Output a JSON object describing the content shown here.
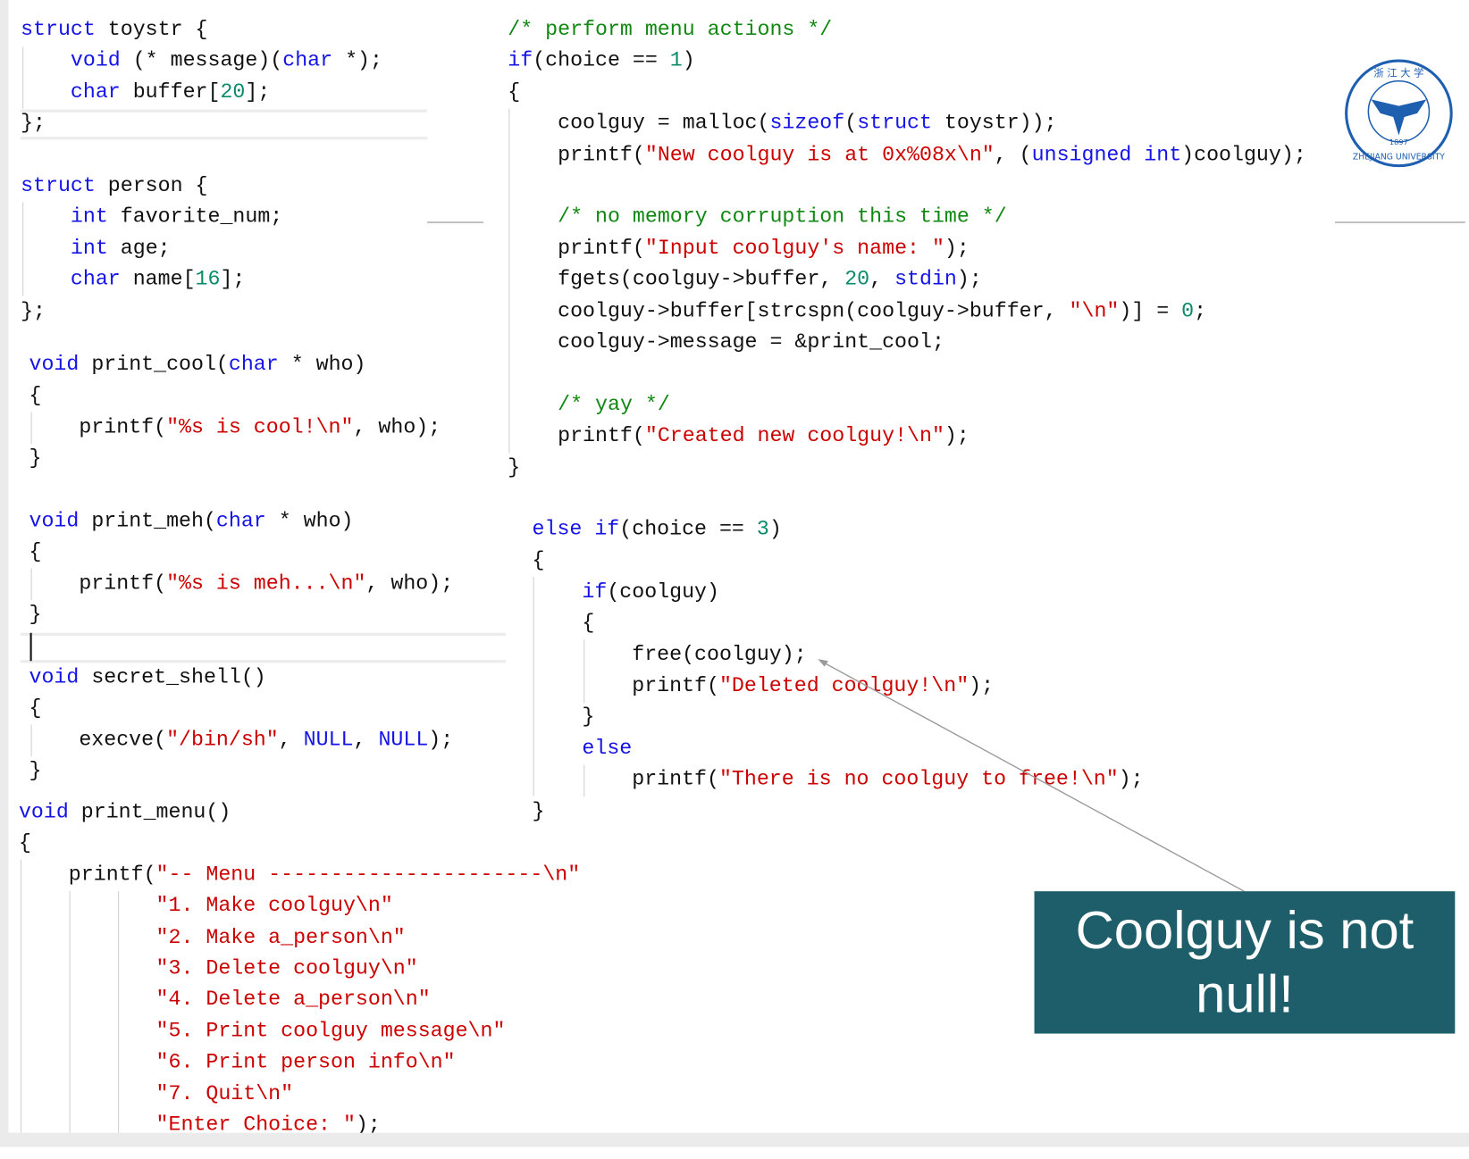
{
  "code_blocks": [
    {
      "name": "struct-definitions",
      "lines": [
        [
          [
            "k",
            "struct"
          ],
          [
            "p",
            " toystr {"
          ]
        ],
        [
          [
            "p",
            "    "
          ],
          [
            "k",
            "void"
          ],
          [
            "p",
            " (* message)("
          ],
          [
            "k",
            "char"
          ],
          [
            "p",
            " *);"
          ]
        ],
        [
          [
            "p",
            "    "
          ],
          [
            "k",
            "char"
          ],
          [
            "p",
            " buffer["
          ],
          [
            "n",
            "20"
          ],
          [
            "p",
            "];"
          ]
        ],
        [
          [
            "p",
            "};"
          ]
        ],
        [],
        [
          [
            "k",
            "struct"
          ],
          [
            "p",
            " person {"
          ]
        ],
        [
          [
            "p",
            "    "
          ],
          [
            "k",
            "int"
          ],
          [
            "p",
            " favorite_num;"
          ]
        ],
        [
          [
            "p",
            "    "
          ],
          [
            "k",
            "int"
          ],
          [
            "p",
            " age;"
          ]
        ],
        [
          [
            "p",
            "    "
          ],
          [
            "k",
            "char"
          ],
          [
            "p",
            " name["
          ],
          [
            "n",
            "16"
          ],
          [
            "p",
            "];"
          ]
        ],
        [
          [
            "p",
            "};"
          ]
        ]
      ]
    },
    {
      "name": "helper-functions",
      "lines": [
        [
          [
            "k",
            "void"
          ],
          [
            "p",
            " print_cool("
          ],
          [
            "k",
            "char"
          ],
          [
            "p",
            " * who)"
          ]
        ],
        [
          [
            "p",
            "{"
          ]
        ],
        [
          [
            "p",
            "    printf("
          ],
          [
            "s",
            "\"%s is cool!\\n\""
          ],
          [
            "p",
            ", who);"
          ]
        ],
        [
          [
            "p",
            "}"
          ]
        ],
        [],
        [
          [
            "k",
            "void"
          ],
          [
            "p",
            " print_meh("
          ],
          [
            "k",
            "char"
          ],
          [
            "p",
            " * who)"
          ]
        ],
        [
          [
            "p",
            "{"
          ]
        ],
        [
          [
            "p",
            "    printf("
          ],
          [
            "s",
            "\"%s is meh...\\n\""
          ],
          [
            "p",
            ", who);"
          ]
        ],
        [
          [
            "p",
            "}"
          ]
        ],
        [],
        [
          [
            "k",
            "void"
          ],
          [
            "p",
            " secret_shell()"
          ]
        ],
        [
          [
            "p",
            "{"
          ]
        ],
        [
          [
            "p",
            "    execve("
          ],
          [
            "s",
            "\"/bin/sh\""
          ],
          [
            "p",
            ", "
          ],
          [
            "k",
            "NULL"
          ],
          [
            "p",
            ", "
          ],
          [
            "k",
            "NULL"
          ],
          [
            "p",
            ");"
          ]
        ],
        [
          [
            "p",
            "}"
          ]
        ]
      ]
    },
    {
      "name": "print-menu-function",
      "lines": [
        [
          [
            "k",
            "void"
          ],
          [
            "p",
            " print_menu()"
          ]
        ],
        [
          [
            "p",
            "{"
          ]
        ],
        [
          [
            "p",
            "    printf("
          ],
          [
            "s",
            "\"-- Menu ----------------------\\n\""
          ]
        ],
        [
          [
            "p",
            "           "
          ],
          [
            "s",
            "\"1. Make coolguy\\n\""
          ]
        ],
        [
          [
            "p",
            "           "
          ],
          [
            "s",
            "\"2. Make a_person\\n\""
          ]
        ],
        [
          [
            "p",
            "           "
          ],
          [
            "s",
            "\"3. Delete coolguy\\n\""
          ]
        ],
        [
          [
            "p",
            "           "
          ],
          [
            "s",
            "\"4. Delete a_person\\n\""
          ]
        ],
        [
          [
            "p",
            "           "
          ],
          [
            "s",
            "\"5. Print coolguy message\\n\""
          ]
        ],
        [
          [
            "p",
            "           "
          ],
          [
            "s",
            "\"6. Print person info\\n\""
          ]
        ],
        [
          [
            "p",
            "           "
          ],
          [
            "s",
            "\"7. Quit\\n\""
          ]
        ],
        [
          [
            "p",
            "           "
          ],
          [
            "s",
            "\"Enter Choice: \""
          ],
          [
            "p",
            ");"
          ]
        ]
      ]
    },
    {
      "name": "menu-action-choice-1",
      "lines": [
        [
          [
            "c",
            "/* perform menu actions */"
          ]
        ],
        [
          [
            "k",
            "if"
          ],
          [
            "p",
            "(choice == "
          ],
          [
            "n",
            "1"
          ],
          [
            "p",
            ")"
          ]
        ],
        [
          [
            "p",
            "{"
          ]
        ],
        [
          [
            "p",
            "    coolguy = malloc("
          ],
          [
            "k",
            "sizeof"
          ],
          [
            "p",
            "("
          ],
          [
            "k",
            "struct"
          ],
          [
            "p",
            " toystr));"
          ]
        ],
        [
          [
            "p",
            "    printf("
          ],
          [
            "s",
            "\"New coolguy is at 0x%08x\\n\""
          ],
          [
            "p",
            ", ("
          ],
          [
            "k",
            "unsigned int"
          ],
          [
            "p",
            ")coolguy);"
          ]
        ],
        [],
        [
          [
            "p",
            "    "
          ],
          [
            "c",
            "/* no memory corruption this time */"
          ]
        ],
        [
          [
            "p",
            "    printf("
          ],
          [
            "s",
            "\"Input coolguy's name: \""
          ],
          [
            "p",
            ");"
          ]
        ],
        [
          [
            "p",
            "    fgets(coolguy->buffer, "
          ],
          [
            "n",
            "20"
          ],
          [
            "p",
            ", "
          ],
          [
            "k",
            "stdin"
          ],
          [
            "p",
            ");"
          ]
        ],
        [
          [
            "p",
            "    coolguy->buffer[strcspn(coolguy->buffer, "
          ],
          [
            "s",
            "\"\\n\""
          ],
          [
            "p",
            ")] = "
          ],
          [
            "n",
            "0"
          ],
          [
            "p",
            ";"
          ]
        ],
        [
          [
            "p",
            "    coolguy->message = &print_cool;"
          ]
        ],
        [],
        [
          [
            "p",
            "    "
          ],
          [
            "c",
            "/* yay */"
          ]
        ],
        [
          [
            "p",
            "    printf("
          ],
          [
            "s",
            "\"Created new coolguy!\\n\""
          ],
          [
            "p",
            ");"
          ]
        ],
        [
          [
            "p",
            "}"
          ]
        ]
      ]
    },
    {
      "name": "menu-action-choice-3",
      "lines": [
        [
          [
            "k",
            "else if"
          ],
          [
            "p",
            "(choice == "
          ],
          [
            "n",
            "3"
          ],
          [
            "p",
            ")"
          ]
        ],
        [
          [
            "p",
            "{"
          ]
        ],
        [
          [
            "p",
            "    "
          ],
          [
            "k",
            "if"
          ],
          [
            "p",
            "(coolguy)"
          ]
        ],
        [
          [
            "p",
            "    {"
          ]
        ],
        [
          [
            "p",
            "        free(coolguy);"
          ]
        ],
        [
          [
            "p",
            "        printf("
          ],
          [
            "s",
            "\"Deleted coolguy!\\n\""
          ],
          [
            "p",
            ");"
          ]
        ],
        [
          [
            "p",
            "    }"
          ]
        ],
        [
          [
            "p",
            "    "
          ],
          [
            "k",
            "else"
          ]
        ],
        [
          [
            "p",
            "        printf("
          ],
          [
            "s",
            "\"There is no coolguy to free!\\n\""
          ],
          [
            "p",
            ");"
          ]
        ],
        [
          [
            "p",
            "}"
          ]
        ]
      ]
    }
  ],
  "callout": {
    "text": "Coolguy is not null!",
    "color": "#1e5e6a"
  },
  "logo": {
    "name": "Zhejiang University seal",
    "text": "ZHEJIANG UNIVERSITY",
    "year": "1897",
    "color": "#1f5fb0"
  }
}
